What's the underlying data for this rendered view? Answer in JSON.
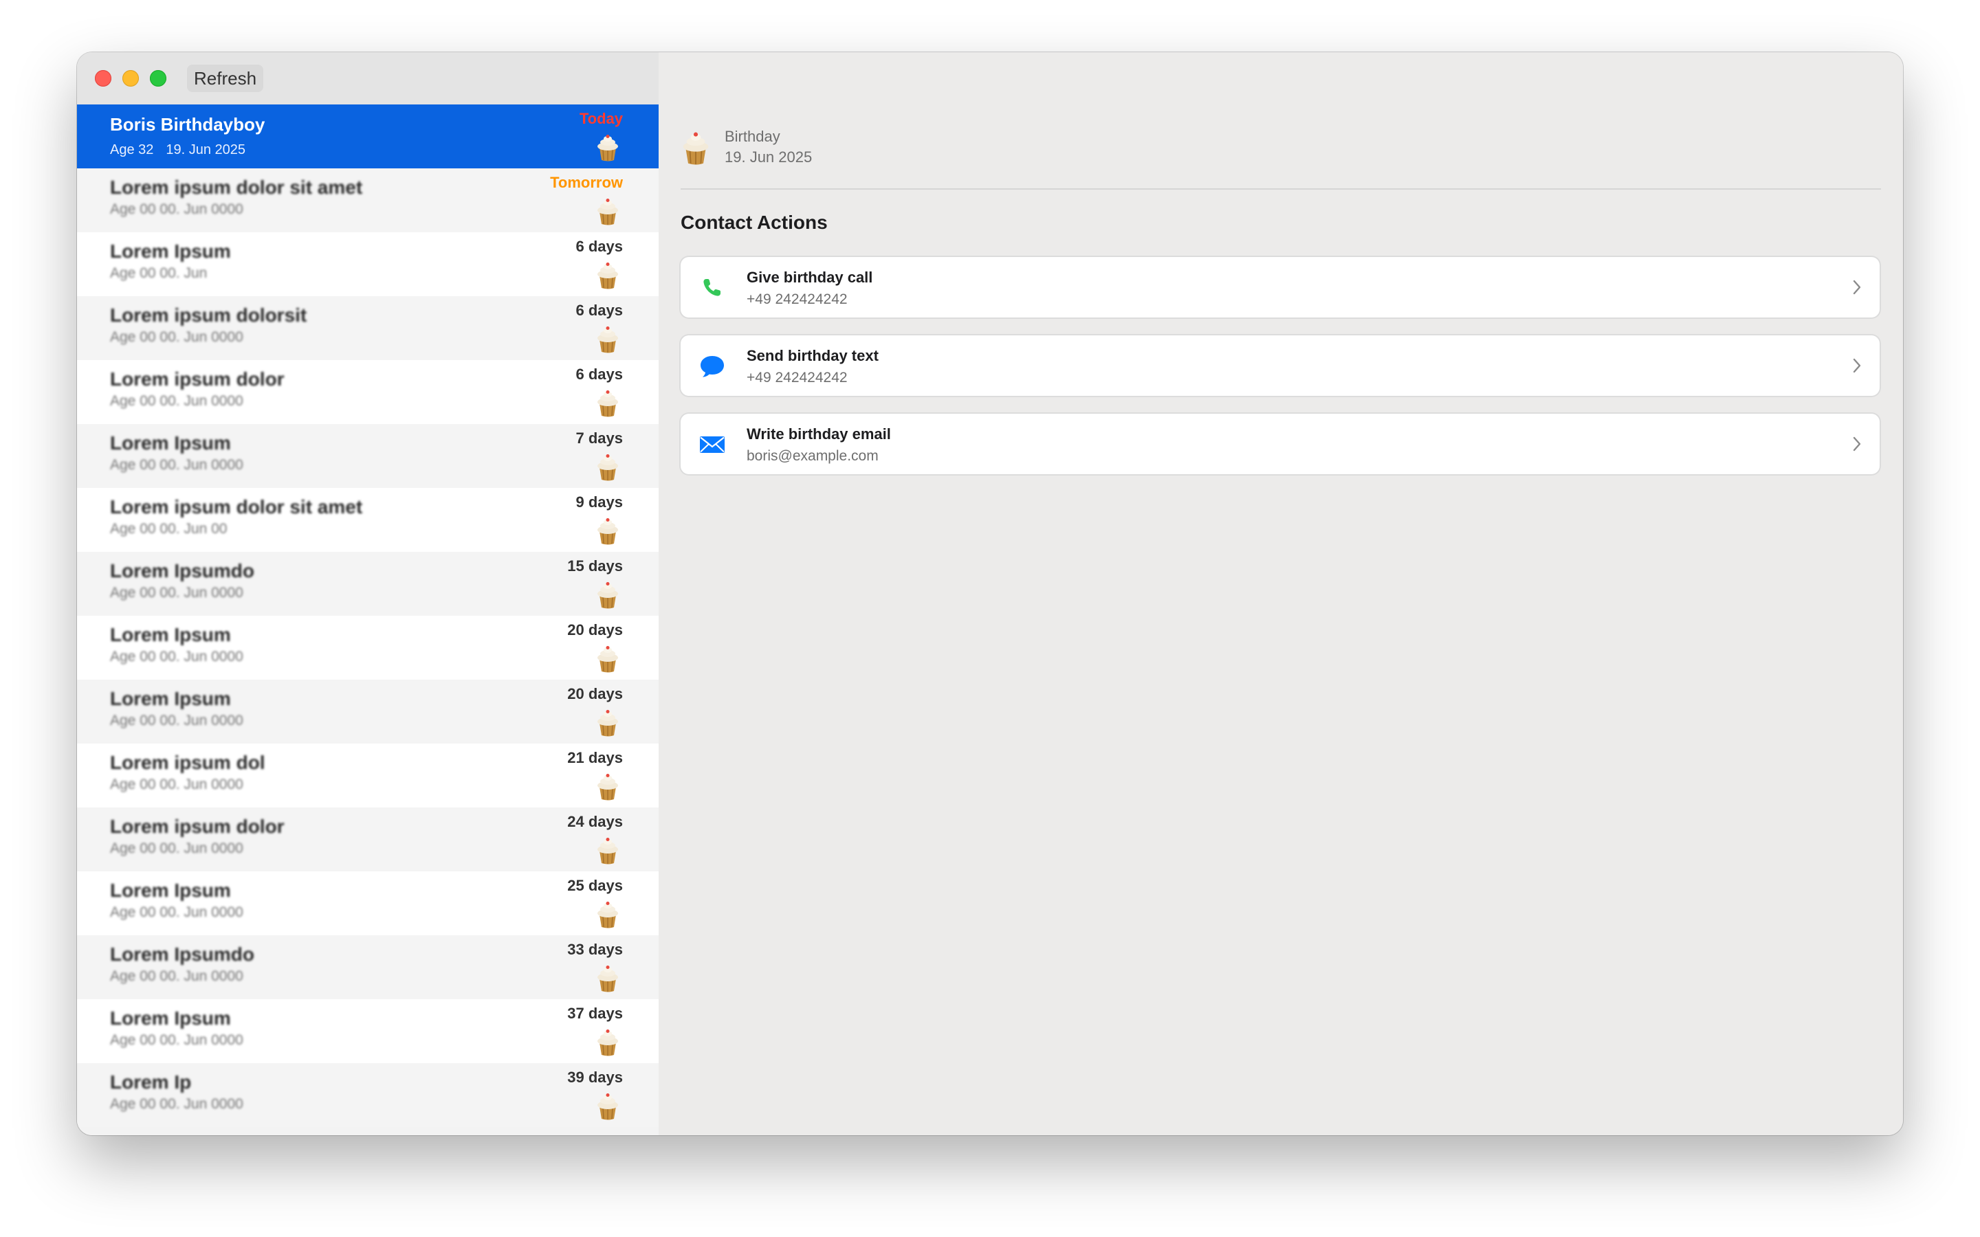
{
  "toolbar": {
    "refresh_label": "Refresh"
  },
  "birthdays": [
    {
      "name": "Boris Birthdayboy",
      "age": "Age 32",
      "date": "19. Jun 2025",
      "due": "Today",
      "selected": true
    },
    {
      "name": "Lorem ipsum dolor sit amet",
      "sub": "Age 00  00. Jun 0000",
      "due": "Tomorrow"
    },
    {
      "name": "Lorem Ipsum",
      "sub": "Age 00 00. Jun",
      "due": "6 days"
    },
    {
      "name": "Lorem ipsum dolorsit",
      "sub": "Age 00  00. Jun 0000",
      "due": "6 days"
    },
    {
      "name": "Lorem ipsum dolor",
      "sub": "Age 00  00. Jun 0000",
      "due": "6 days"
    },
    {
      "name": "Lorem Ipsum",
      "sub": "Age 00  00. Jun 0000",
      "due": "7 days"
    },
    {
      "name": "Lorem ipsum dolor sit amet",
      "sub": "Age 00  00. Jun 00",
      "due": "9 days"
    },
    {
      "name": "Lorem Ipsumdo",
      "sub": "Age 00  00. Jun 0000",
      "due": "15 days"
    },
    {
      "name": "Lorem Ipsum",
      "sub": "Age 00  00. Jun 0000",
      "due": "20 days"
    },
    {
      "name": "Lorem Ipsum",
      "sub": "Age 00  00. Jun 0000",
      "due": "20 days"
    },
    {
      "name": "Lorem ipsum dol",
      "sub": "Age 00  00. Jun 0000",
      "due": "21 days"
    },
    {
      "name": "Lorem ipsum dolor",
      "sub": "Age 00  00. Jun 0000",
      "due": "24 days"
    },
    {
      "name": "Lorem Ipsum",
      "sub": "Age 00  00. Jun 0000",
      "due": "25 days"
    },
    {
      "name": "Lorem Ipsumdo",
      "sub": "Age 00  00. Jun 0000",
      "due": "33 days"
    },
    {
      "name": "Lorem Ipsum",
      "sub": "Age 00  00. Jun 0000",
      "due": "37 days"
    },
    {
      "name": "Lorem Ip",
      "sub": "Age 00  00. Jun 0000",
      "due": "39 days"
    }
  ],
  "detail": {
    "birthday_label": "Birthday",
    "birthday_date": "19. Jun 2025",
    "section_title": "Contact Actions",
    "actions": [
      {
        "title": "Give birthday call",
        "subtitle": "+49 242424242",
        "icon": "phone-icon",
        "color": "#34c759"
      },
      {
        "title": "Send birthday text",
        "subtitle": "+49 242424242",
        "icon": "message-bubble-icon",
        "color": "#0a7aff"
      },
      {
        "title": "Write birthday email",
        "subtitle": "boris@example.com",
        "icon": "envelope-icon",
        "color": "#0a7aff"
      }
    ]
  },
  "colors": {
    "selection": "#0a63e0",
    "today": "#ff3b30",
    "tomorrow": "#ff9500"
  }
}
